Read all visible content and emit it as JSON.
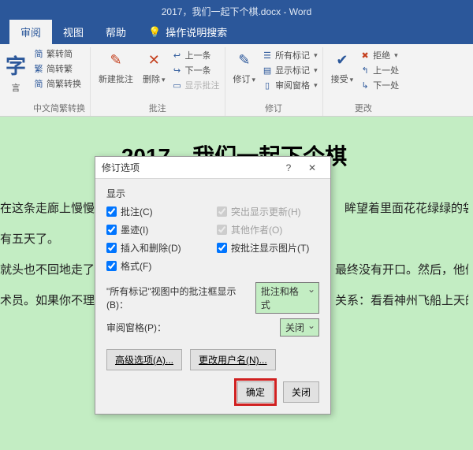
{
  "title": "2017，我们一起下个棋.docx - Word",
  "tabs": {
    "review": "审阅",
    "view": "视图",
    "help": "帮助",
    "search": "操作说明搜索"
  },
  "ribbon": {
    "char_big": "字",
    "char_small": "言",
    "simpl": {
      "a": "繁转简",
      "b": "简转繁",
      "c": "简繁转换",
      "label": "中文简繁转换"
    },
    "comment": {
      "new": "新建批注",
      "del": "删除",
      "prev": "上一条",
      "next": "下一条",
      "show": "显示批注",
      "label": "批注"
    },
    "track": {
      "btn": "修订",
      "all": "所有标记",
      "showmk": "显示标记",
      "pane": "审阅窗格",
      "label": "修订"
    },
    "accept": {
      "btn": "接受",
      "reject": "拒绝",
      "prev": "上一处",
      "next": "下一处",
      "label": "更改"
    }
  },
  "doc": {
    "title": "2017，我们一起下个棋",
    "p1": "在这条走廊上慢慢地",
    "p1b": "眸望着里面花花绿绿的袋子让",
    "p2": "有五天了。",
    "p3": "就头也不回地走了。",
    "p3b": "最终没有开口。然后，他们",
    "p4": "术员。如果你不理解",
    "p4b": "关系：看看神州飞船上天的"
  },
  "dialog": {
    "title": "修订选项",
    "show": "显示",
    "chk": {
      "comments": "批注(C)",
      "ink": "墨迹(I)",
      "insdel": "插入和删除(D)",
      "fmt": "格式(F)",
      "upd": "突出显示更新(H)",
      "others": "其他作者(O)",
      "pic": "按批注显示图片(T)"
    },
    "row1": "\"所有标记\"视图中的批注框显示(B)：",
    "row1v": "批注和格式",
    "row2": "审阅窗格(P)：",
    "row2v": "关闭",
    "adv": "高级选项(A)...",
    "user": "更改用户名(N)...",
    "ok": "确定",
    "cancel": "关闭"
  }
}
